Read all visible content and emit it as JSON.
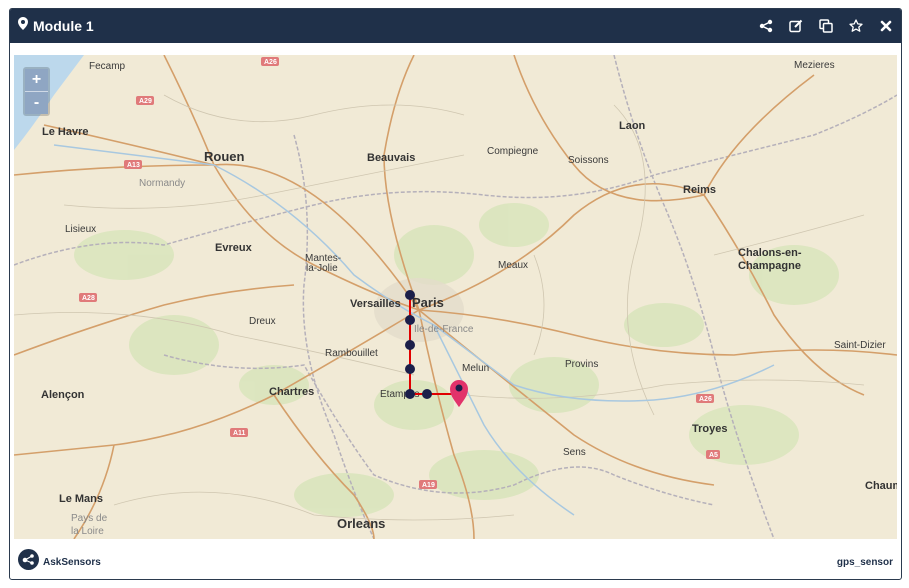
{
  "header": {
    "title": "Module 1",
    "icons": [
      "share-icon",
      "edit-icon",
      "copy-icon",
      "star-icon",
      "close-icon"
    ]
  },
  "map": {
    "zoom_in": "+",
    "zoom_out": "-",
    "cities": [
      {
        "name": "Fecamp"
      },
      {
        "name": "Mezieres"
      },
      {
        "name": "Le Havre"
      },
      {
        "name": "Rouen"
      },
      {
        "name": "Beauvais"
      },
      {
        "name": "Compiegne"
      },
      {
        "name": "Soissons"
      },
      {
        "name": "Laon"
      },
      {
        "name": "Reims"
      },
      {
        "name": "Normandy"
      },
      {
        "name": "Lisieux"
      },
      {
        "name": "Evreux"
      },
      {
        "name": "Mantes-"
      },
      {
        "name": "la-Jolie"
      },
      {
        "name": "Meaux"
      },
      {
        "name": "Chalons-en-"
      },
      {
        "name": "Champagne"
      },
      {
        "name": "Versailles"
      },
      {
        "name": "Paris"
      },
      {
        "name": "Dreux"
      },
      {
        "name": "Ile-de-France"
      },
      {
        "name": "Rambouillet"
      },
      {
        "name": "Melun"
      },
      {
        "name": "Provins"
      },
      {
        "name": "Saint-Dizier"
      },
      {
        "name": "Alençon"
      },
      {
        "name": "Chartres"
      },
      {
        "name": "Etampes"
      },
      {
        "name": "Troyes"
      },
      {
        "name": "Sens"
      },
      {
        "name": "Le Mans"
      },
      {
        "name": "Pays de"
      },
      {
        "name": "la Loire"
      },
      {
        "name": "Orleans"
      },
      {
        "name": "Chaum"
      }
    ],
    "roads": [
      "A26",
      "A29",
      "A13",
      "A28",
      "A11",
      "A19",
      "A26",
      "A5"
    ]
  },
  "footer": {
    "brand": "AskSensors",
    "sensor": "gps_sensor"
  },
  "colors": {
    "header_bg": "#1f3049",
    "track": "#e00000",
    "track_points": "#1b1f4a",
    "marker": "#e2336b"
  }
}
